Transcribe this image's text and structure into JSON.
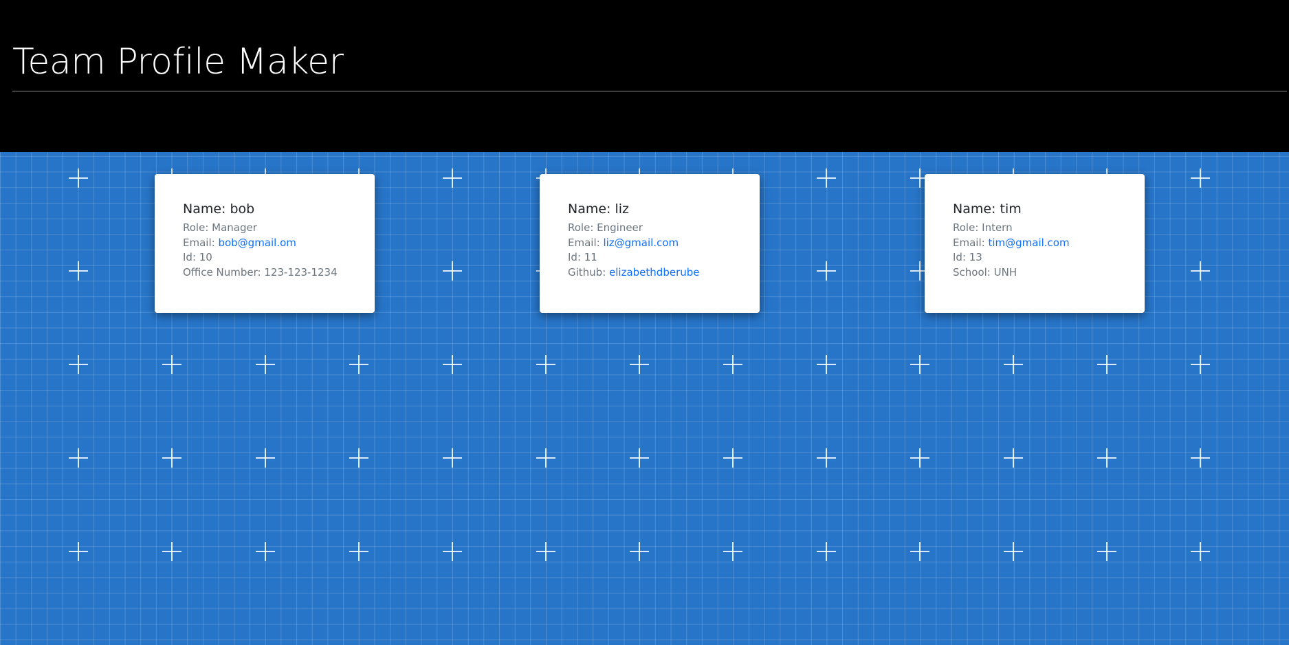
{
  "header": {
    "title": "Team Profile Maker"
  },
  "colors": {
    "header_bg": "#000000",
    "background": "#2775c9",
    "link": "#0d6efd",
    "muted_text": "#6c757d"
  },
  "cards": [
    {
      "name": "Name: bob",
      "role_label": "Role: Manager",
      "email_label": "Email: ",
      "email": "bob@gmail.om",
      "id_label": "Id: 10",
      "extra_label": "Office Number: 123-123-1234",
      "extra_link": ""
    },
    {
      "name": "Name: liz",
      "role_label": "Role: Engineer",
      "email_label": "Email: ",
      "email": "liz@gmail.com",
      "id_label": "Id: 11",
      "extra_label": "Github: ",
      "extra_link": "elizabethdberube"
    },
    {
      "name": "Name: tim",
      "role_label": "Role: Intern",
      "email_label": "Email: ",
      "email": "tim@gmail.com",
      "id_label": "Id: 13",
      "extra_label": "School: UNH",
      "extra_link": ""
    }
  ]
}
